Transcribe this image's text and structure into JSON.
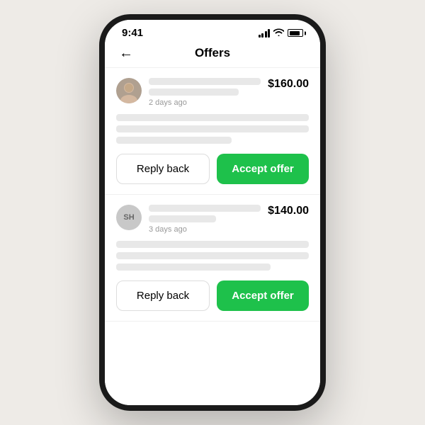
{
  "status_bar": {
    "time": "9:41"
  },
  "nav": {
    "title": "Offers",
    "back_label": "←"
  },
  "offers": [
    {
      "id": "offer-1",
      "avatar_type": "image",
      "avatar_initials": "",
      "price": "$160.00",
      "timestamp": "2 days ago",
      "btn_reply": "Reply back",
      "btn_accept": "Accept offer"
    },
    {
      "id": "offer-2",
      "avatar_type": "initials",
      "avatar_initials": "SH",
      "price": "$140.00",
      "timestamp": "3 days ago",
      "btn_reply": "Reply back",
      "btn_accept": "Accept offer"
    }
  ],
  "colors": {
    "accent_green": "#1ec14b",
    "skeleton": "#e8e8e8",
    "border": "#ddd"
  }
}
